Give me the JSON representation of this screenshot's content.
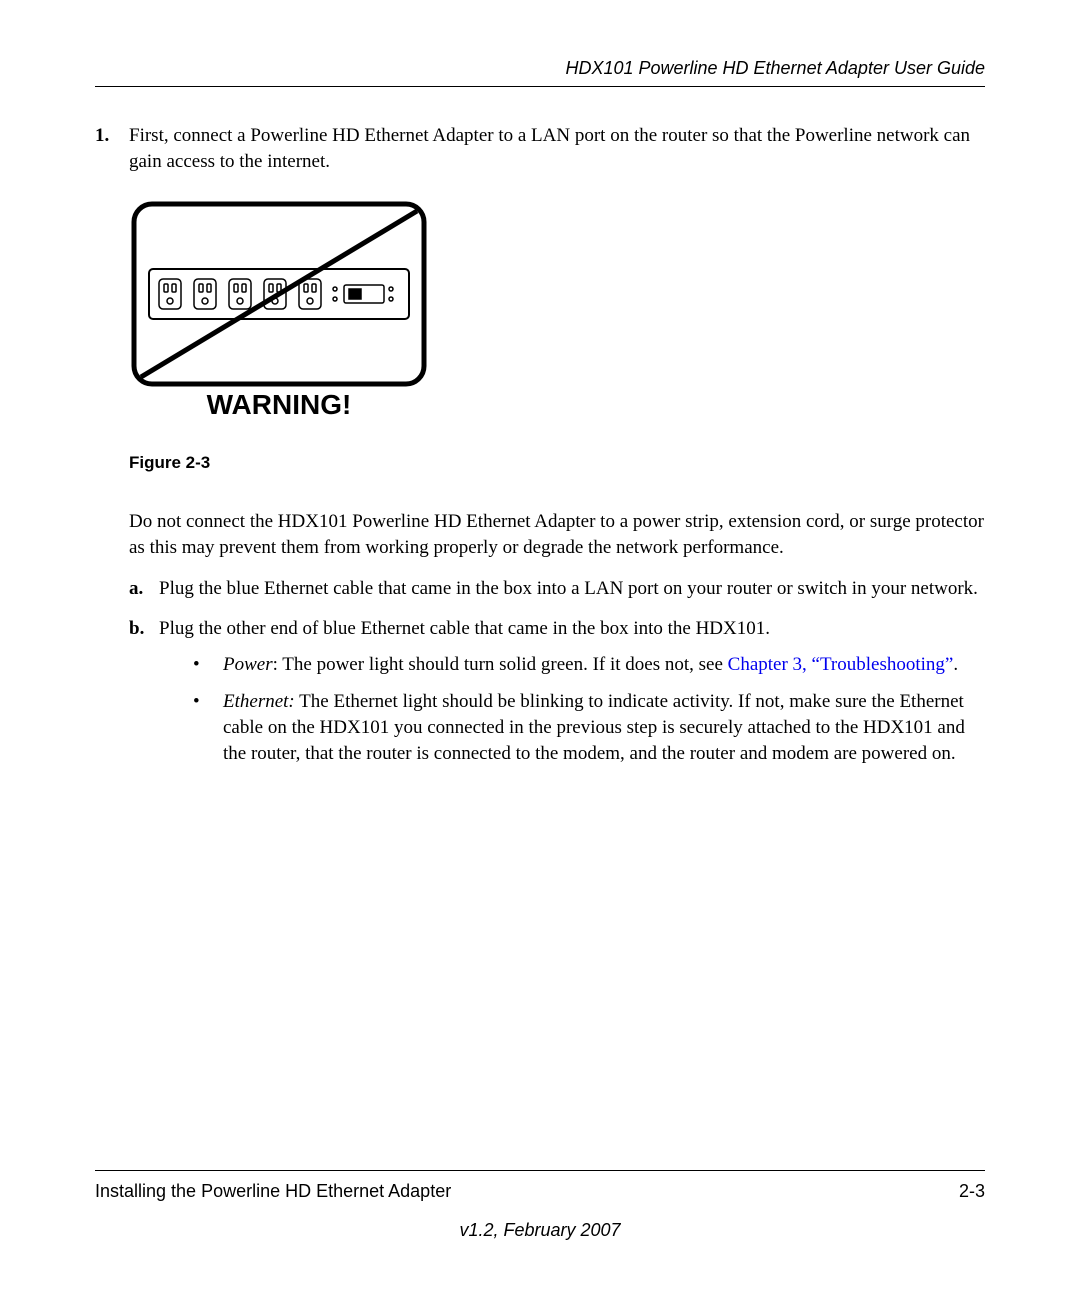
{
  "header": {
    "title": "HDX101 Powerline HD Ethernet Adapter User Guide"
  },
  "main_item": {
    "number": "1.",
    "text": "First, connect a Powerline HD Ethernet Adapter to a LAN port on the router so that the Powerline network can gain access to the internet."
  },
  "figure": {
    "warning_text": "WARNING!",
    "caption": "Figure 2-3"
  },
  "paragraph": "Do not connect the HDX101 Powerline HD Ethernet Adapter to a power strip, extension cord, or surge protector as this may prevent them from working properly or degrade the network performance.",
  "sub_a": {
    "marker": "a.",
    "text": "Plug the blue Ethernet cable that came in the box into a LAN port on your router or switch in your network."
  },
  "sub_b": {
    "marker": "b.",
    "text": "Plug the other end of blue Ethernet cable that came in the box into the HDX101."
  },
  "bullet1": {
    "label_italic": "Power",
    "text_before_link": ": The power light should turn solid green. If it does not, see ",
    "link_text": "Chapter 3, “Troubleshooting”",
    "text_after_link": "."
  },
  "bullet2": {
    "label_italic": "Ethernet:",
    "text": " The Ethernet light should be blinking to indicate activity. If not, make sure the Ethernet cable on the HDX101 you connected in the previous step is securely attached to the HDX101 and the router, that the router is connected to the modem, and the router and modem are powered on."
  },
  "footer": {
    "left": "Installing the Powerline HD Ethernet Adapter",
    "right": "2-3",
    "version": "v1.2, February 2007"
  }
}
